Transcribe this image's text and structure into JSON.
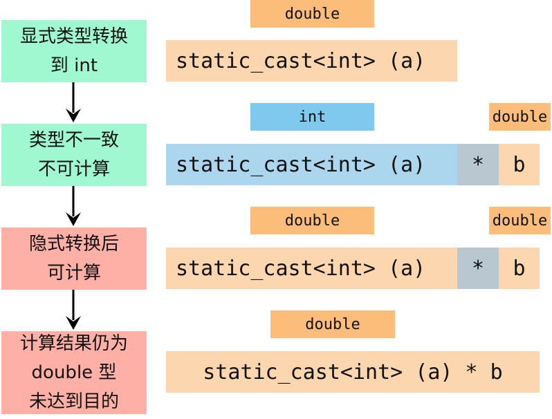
{
  "steps": [
    {
      "lines": [
        "显式类型转换",
        "到 int"
      ],
      "color": "#a0f8d0"
    },
    {
      "lines": [
        "类型不一致",
        "不可计算"
      ],
      "color": "#a0f8d0"
    },
    {
      "lines": [
        "隐式转换后",
        "可计算"
      ],
      "color": "#ffb0a6"
    },
    {
      "lines": [
        "计算结果仍为",
        "double 型",
        "未达到目的"
      ],
      "color": "#ffb0a6"
    }
  ],
  "rows": [
    {
      "tags": [
        "double"
      ],
      "expr": [
        "static_cast<int> (a)"
      ]
    },
    {
      "tags": [
        "int",
        "double"
      ],
      "expr": [
        "static_cast<int> (a)",
        "*",
        "b"
      ]
    },
    {
      "tags": [
        "double",
        "double"
      ],
      "expr": [
        "static_cast<int> (a)",
        "*",
        "b"
      ]
    },
    {
      "tags": [
        "double"
      ],
      "expr": [
        "static_cast<int> (a) * b"
      ]
    }
  ],
  "colors": {
    "green_box": "#a0f8d0",
    "red_box": "#ffb0a6",
    "orange_tag": "#fdbd7a",
    "blue_tag": "#7fc9ef",
    "peach_expr": "#fcd6ae",
    "blue_expr": "#acd6ed",
    "grey_operator": "#b9c7d1"
  }
}
